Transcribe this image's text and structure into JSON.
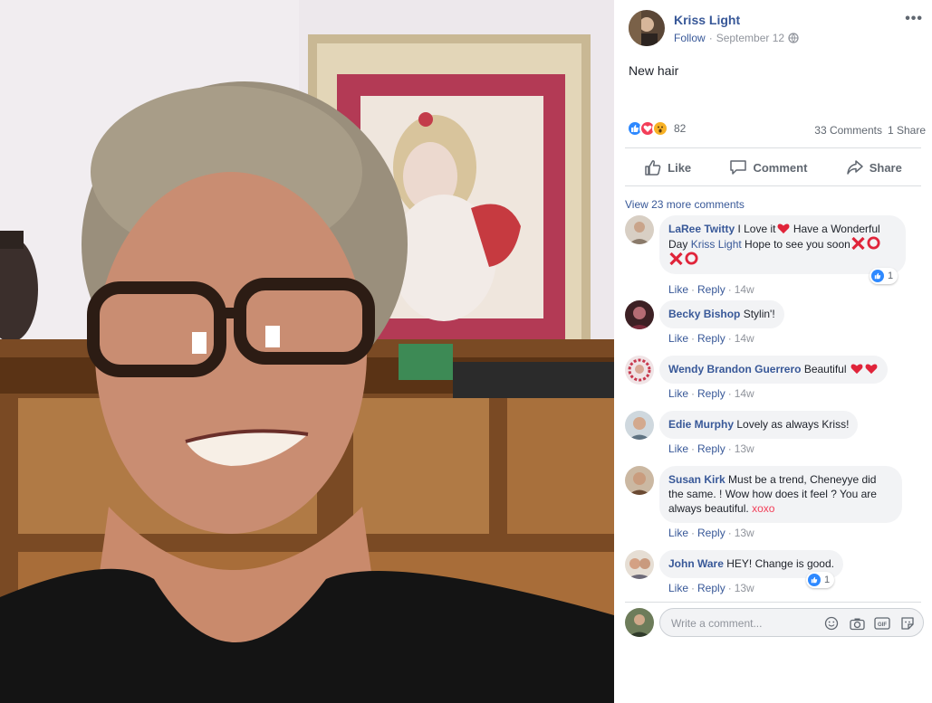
{
  "post": {
    "author": "Kriss Light",
    "follow_label": "Follow",
    "dot": "·",
    "date": "September 12",
    "more_label": "•••",
    "text": "New hair",
    "reactions_count": "82",
    "comments_count": "33 Comments",
    "shares_count": "1 Share"
  },
  "actions": {
    "like": "Like",
    "comment": "Comment",
    "share": "Share"
  },
  "comments_section": {
    "view_more": "View 23 more comments",
    "foot_like": "Like",
    "foot_reply": "Reply",
    "dot": "·",
    "items": [
      {
        "name": "LaRee Twitty",
        "text1": "I Love it",
        "text2": " Have a Wonderful Day ",
        "mention": "Kriss Light",
        "text3": " Hope to see you soon",
        "time": "14w",
        "likes": "1"
      },
      {
        "name": "Becky Bishop",
        "text": "Stylin'!",
        "time": "14w"
      },
      {
        "name": "Wendy Brandon Guerrero",
        "text": "Beautiful ",
        "time": "14w"
      },
      {
        "name": "Edie Murphy",
        "text": "Lovely as always Kriss!",
        "time": "13w"
      },
      {
        "name": "Susan Kirk",
        "text": "Must be a trend, Cheneyye did the same. ! Wow how does it feel ? You are always beautiful. ",
        "xoxo": "xoxo",
        "time": "13w"
      },
      {
        "name": "John Ware",
        "text": "HEY! Change is good.",
        "time": "13w",
        "likes": "1"
      }
    ]
  },
  "composer": {
    "placeholder": "Write a comment..."
  },
  "colors": {
    "link": "#385898",
    "like_blue": "#2e89ff",
    "love_red": "#f33e58",
    "wow_yellow": "#f7b125"
  }
}
